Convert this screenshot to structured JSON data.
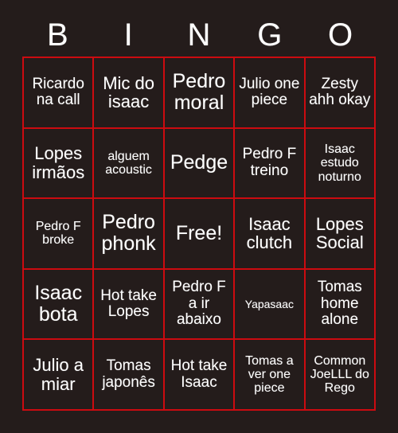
{
  "card": {
    "background_color": "#241c1b",
    "grid_line_color": "#cc0b10",
    "text_color": "#ffffff"
  },
  "header": {
    "letters": [
      "B",
      "I",
      "N",
      "G",
      "O"
    ]
  },
  "grid": {
    "columns": 5,
    "rows": 5,
    "free_space_index": 12,
    "cells": [
      {
        "text": "Ricardo na call",
        "size": "fs-md"
      },
      {
        "text": "Mic do isaac",
        "size": "fs-lg"
      },
      {
        "text": "Pedro moral",
        "size": "fs-xl"
      },
      {
        "text": "Julio one piece",
        "size": "fs-md"
      },
      {
        "text": "Zesty ahh okay",
        "size": "fs-md"
      },
      {
        "text": "Lopes irmãos",
        "size": "fs-lg"
      },
      {
        "text": "alguem acoustic",
        "size": "fs-sm"
      },
      {
        "text": "Pedge",
        "size": "fs-xl"
      },
      {
        "text": "Pedro F treino",
        "size": "fs-md"
      },
      {
        "text": "Isaac estudo noturno",
        "size": "fs-sm"
      },
      {
        "text": "Pedro F broke",
        "size": "fs-sm"
      },
      {
        "text": "Pedro phonk",
        "size": "fs-xl"
      },
      {
        "text": "Free!",
        "size": "fs-xl"
      },
      {
        "text": "Isaac clutch",
        "size": "fs-lg"
      },
      {
        "text": "Lopes Social",
        "size": "fs-lg"
      },
      {
        "text": "Isaac bota",
        "size": "fs-xl"
      },
      {
        "text": "Hot take Lopes",
        "size": "fs-md"
      },
      {
        "text": "Pedro F a ir abaixo",
        "size": "fs-md"
      },
      {
        "text": "Yapasaac",
        "size": "fs-xs"
      },
      {
        "text": "Tomas home alone",
        "size": "fs-md"
      },
      {
        "text": "Julio a miar",
        "size": "fs-lg"
      },
      {
        "text": "Tomas japonês",
        "size": "fs-md"
      },
      {
        "text": "Hot take Isaac",
        "size": "fs-md"
      },
      {
        "text": "Tomas a ver one piece",
        "size": "fs-sm"
      },
      {
        "text": "Common JoeLLL do Rego",
        "size": "fs-sm"
      }
    ]
  }
}
